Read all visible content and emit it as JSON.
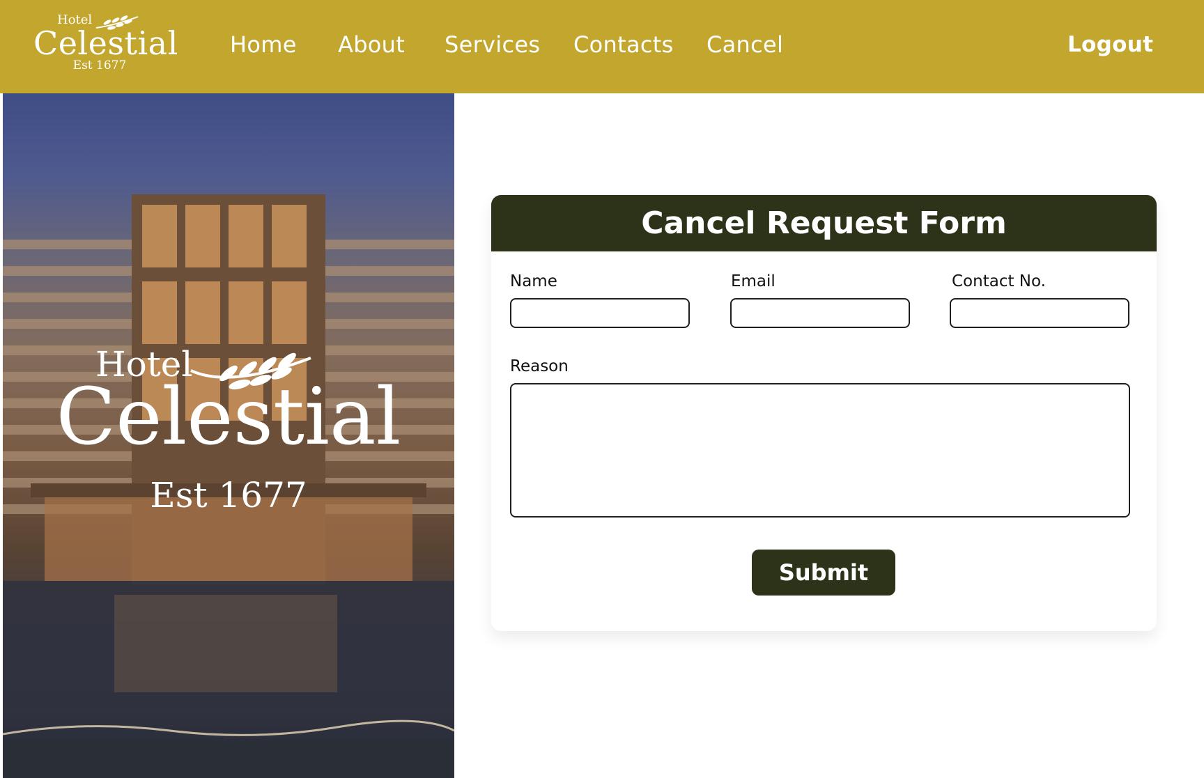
{
  "brand": {
    "top": "Hotel",
    "name": "Celestial",
    "est": "Est 1677"
  },
  "nav": {
    "home": "Home",
    "about": "About",
    "services": "Services",
    "contacts": "Contacts",
    "cancel": "Cancel",
    "logout": "Logout"
  },
  "hero": {
    "image_description": "hotel-facade-photo",
    "logo_top": "Hotel",
    "logo_name": "Celestial",
    "logo_est": "Est 1677"
  },
  "form": {
    "title": "Cancel Request Form",
    "name_label": "Name",
    "name_value": "",
    "email_label": "Email",
    "email_value": "",
    "contact_label": "Contact No.",
    "contact_value": "",
    "reason_label": "Reason",
    "reason_value": "",
    "submit_label": "Submit"
  },
  "colors": {
    "header_bg": "#c2a62d",
    "form_header_bg": "#2c3318",
    "button_bg": "#2c3318"
  }
}
